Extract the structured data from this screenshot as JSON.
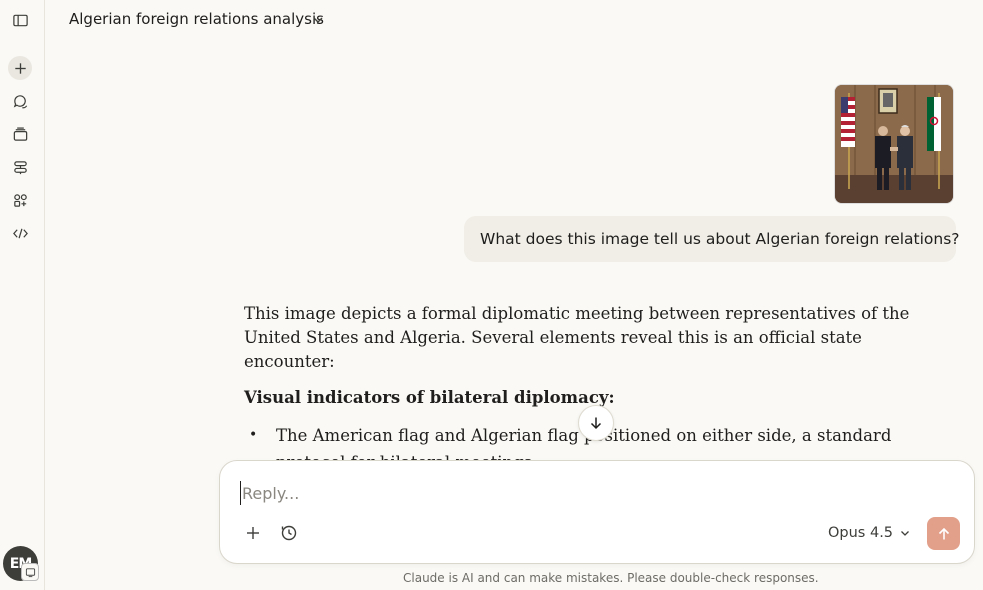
{
  "header": {
    "title": "Algerian foreign relations analysis"
  },
  "sidebar": {
    "items": [
      {
        "icon": "sidebar-toggle-icon"
      },
      {
        "icon": "plus-icon"
      },
      {
        "icon": "chats-icon"
      },
      {
        "icon": "projects-icon"
      },
      {
        "icon": "artifacts-icon"
      },
      {
        "icon": "apps-icon"
      },
      {
        "icon": "code-icon"
      }
    ],
    "avatar_initials": "EM"
  },
  "conversation": {
    "user_message": "What does this image tell us about Algerian foreign relations?",
    "response": {
      "intro": "This image depicts a formal diplomatic meeting between representatives of the United States and Algeria. Several elements reveal this is an official state encounter:",
      "heading": "Visual indicators of bilateral diplomacy:",
      "bullets": [
        "The American flag and Algerian flag positioned on either side, a standard protocol for bilateral meetings"
      ]
    }
  },
  "composer": {
    "placeholder": "Reply...",
    "model": "Opus 4.5"
  },
  "footer": {
    "disclaimer": "Claude is AI and can make mistakes. Please double-check responses."
  },
  "colors": {
    "background": "#faf9f5",
    "user_bubble": "#f0eee6",
    "send_button": "#e2a08a"
  }
}
